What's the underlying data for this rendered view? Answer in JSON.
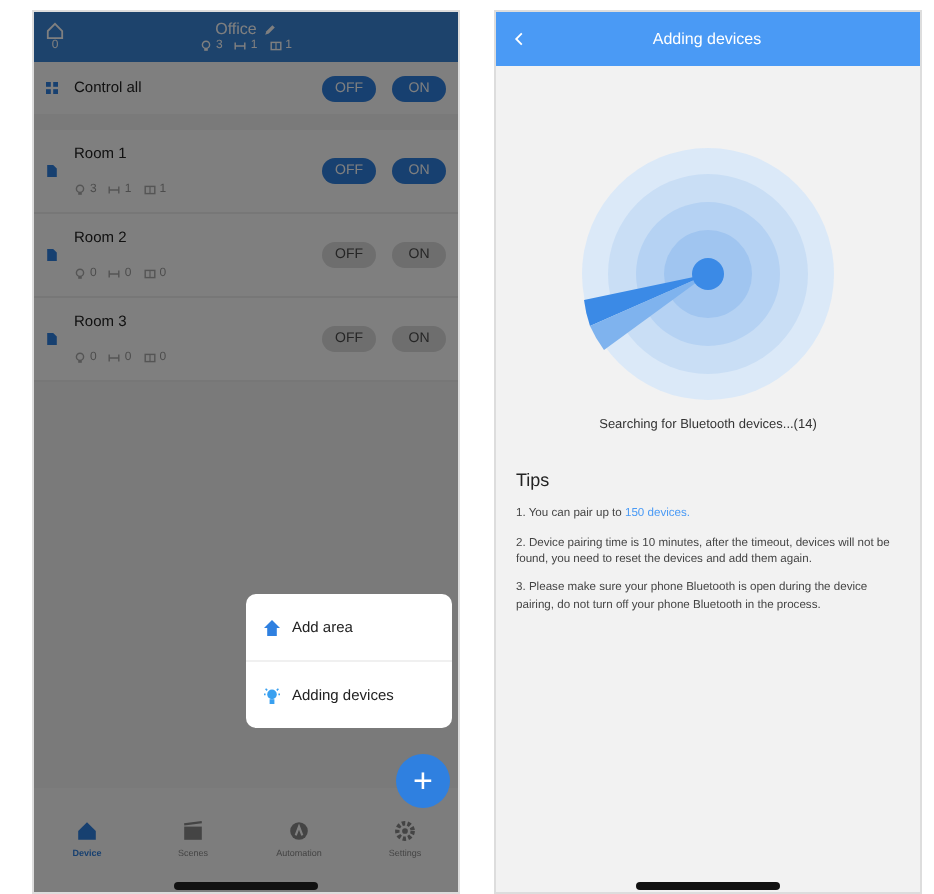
{
  "device_screen": {
    "header": {
      "title": "Office",
      "home_count": "0",
      "stats": [
        "3",
        "1",
        "1"
      ]
    },
    "control_all": {
      "label": "Control all",
      "off": "OFF",
      "on": "ON",
      "enabled": true
    },
    "rooms": [
      {
        "name": "Room 1",
        "stats": [
          "3",
          "1",
          "1"
        ],
        "off": "OFF",
        "on": "ON",
        "enabled": true
      },
      {
        "name": "Room 2",
        "stats": [
          "0",
          "0",
          "0"
        ],
        "off": "OFF",
        "on": "ON",
        "enabled": false
      },
      {
        "name": "Room 3",
        "stats": [
          "0",
          "0",
          "0"
        ],
        "off": "OFF",
        "on": "ON",
        "enabled": false
      }
    ],
    "menu": [
      {
        "kind": "area",
        "label": "Add area"
      },
      {
        "kind": "device",
        "label": "Adding devices"
      }
    ],
    "fab": "+",
    "tabs": [
      {
        "kind": "device",
        "label": "Device",
        "selected": true
      },
      {
        "kind": "scenes",
        "label": "Scenes",
        "selected": false
      },
      {
        "kind": "automation",
        "label": "Automation",
        "selected": false
      },
      {
        "kind": "settings",
        "label": "Settings",
        "selected": false
      }
    ]
  },
  "adding_screen": {
    "title": "Adding devices",
    "status": "Searching for Bluetooth devices...(14)",
    "tips_title": "Tips",
    "tips": [
      {
        "text": "1. You can pair up to ",
        "link": "150 devices."
      },
      {
        "text": "2. Device pairing time is 10 minutes, after the timeout, devices will not be found, you need to reset the devices and add them again."
      },
      {
        "text": "3.  Please make sure your phone Bluetooth is open during the device pairing, do not turn off your phone Bluetooth in the process."
      }
    ]
  }
}
